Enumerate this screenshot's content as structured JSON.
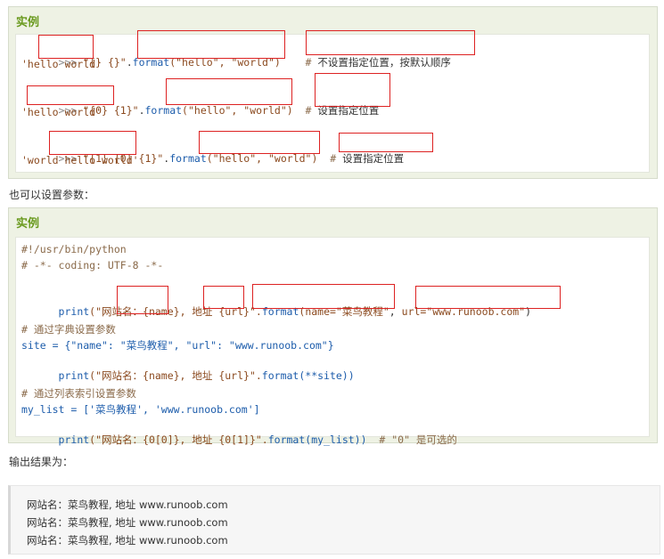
{
  "example1": {
    "title": "实例",
    "lines": [
      {
        "prompt": ">>> ",
        "str1": "\"{} {}\"",
        "dot": ".",
        "fn": "format",
        "args": "(\"hello\", \"world\")",
        "comment": "# ",
        "note": "不设置指定位置，按默认顺序"
      },
      {
        "output": "'hello world'"
      },
      {
        "prompt": ">>> ",
        "str1": "\"{0} {1}\"",
        "dot": ".",
        "fn": "format",
        "args": "(\"hello\", \"world\")",
        "comment": "# ",
        "note": "设置指定位置"
      },
      {
        "output": "'hello world'"
      },
      {
        "prompt": ">>> ",
        "str1": "\"{1} {0} {1}\"",
        "dot": ".",
        "fn": "format",
        "args": "(\"hello\", \"world\")",
        "comment": "# ",
        "note": "设置指定位置"
      },
      {
        "output": "'world hello world'"
      }
    ]
  },
  "para1": "也可以设置参数：",
  "example2": {
    "title": "实例",
    "l1": "#!/usr/bin/python",
    "l2": "# -*- coding: UTF-8 -*-",
    "l3a": "print",
    "l3b": "(\"网站名：",
    "l3c": "{name}",
    "l3d": ", 地址 ",
    "l3e": "{url}",
    "l3f": "\".",
    "l3g": "format",
    "l3h": "(name=\"菜鸟教程\"",
    "l3i": ", ",
    "l3j": "url=\"www.runoob.com\"",
    "l3k": ")",
    "l4": "# 通过字典设置参数",
    "l5": "site = {\"name\": \"菜鸟教程\", \"url\": \"www.runoob.com\"}",
    "l6a": "print",
    "l6b": "(\"网站名：{name}, 地址 {url}\".",
    "l6c": "format",
    "l6d": "(**site))",
    "l7": "# 通过列表索引设置参数",
    "l8": "my_list = ['菜鸟教程', 'www.runoob.com']",
    "l9a": "print",
    "l9b": "(\"网站名：{0[0]}, 地址 {0[1]}\".",
    "l9c": "format",
    "l9d": "(my_list))",
    "l9e": "  # \"0\" 是可选的"
  },
  "para2": "输出结果为：",
  "result": [
    "网站名：菜鸟教程, 地址 www.runoob.com",
    "网站名：菜鸟教程, 地址 www.runoob.com",
    "网站名：菜鸟教程, 地址 www.runoob.com"
  ]
}
